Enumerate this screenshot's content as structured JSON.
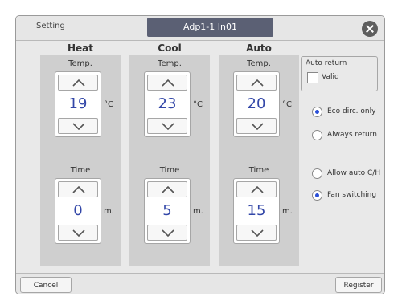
{
  "header": {
    "title": "Setting",
    "unit_name": "Adp1-1 In01",
    "close_icon": "close-icon"
  },
  "columns": [
    {
      "title": "Heat",
      "temp_label": "Temp.",
      "temp_value": "19",
      "temp_unit": "°C",
      "time_label": "Time",
      "time_value": "0",
      "time_unit": "m."
    },
    {
      "title": "Cool",
      "temp_label": "Temp.",
      "temp_value": "23",
      "temp_unit": "°C",
      "time_label": "Time",
      "time_value": "5",
      "time_unit": "m."
    },
    {
      "title": "Auto",
      "temp_label": "Temp.",
      "temp_value": "20",
      "temp_unit": "°C",
      "time_label": "Time",
      "time_value": "15",
      "time_unit": "m."
    }
  ],
  "auto_return": {
    "label": "Auto return",
    "checkbox_label": "Valid",
    "checked": false
  },
  "radios_return": [
    {
      "label": "Eco dirc. only",
      "selected": true
    },
    {
      "label": "Always return",
      "selected": false
    }
  ],
  "radios_mode": [
    {
      "label": "Allow auto C/H",
      "selected": false
    },
    {
      "label": "Fan switching",
      "selected": true
    }
  ],
  "footer": {
    "cancel_label": "Cancel",
    "register_label": "Register"
  },
  "colors": {
    "value_text": "#3347a8",
    "title_bar": "#5b6074",
    "radio_selected": "#2a4fd8",
    "panel_bg": "#cfcfcf"
  }
}
